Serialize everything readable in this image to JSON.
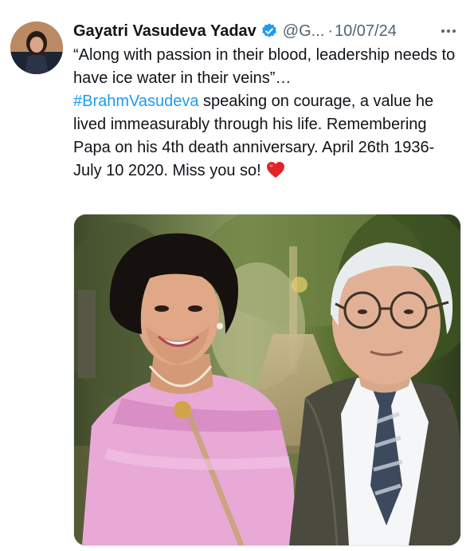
{
  "tweet": {
    "author_name": "Gayatri Vasudeva Yadav",
    "handle": "@G...",
    "separator": "·",
    "date": "10/07/24",
    "text_line1": "“Along with passion in their blood, leadership needs to have ice water in their veins”…",
    "hashtag": "#BrahmVasudeva",
    "text_line2": " speaking on courage, a value he lived immeasurably through his life. Remembering Papa on his 4th death anniversary. April 26th 1936-July 10 2020. Miss you so!",
    "icons": {
      "verified": "verified-badge-icon",
      "more": "more-options-icon",
      "heart": "red-heart-emoji"
    },
    "colors": {
      "hashtag": "#1d9bf0",
      "verified": "#1d9bf0",
      "secondary_text": "#536471",
      "heart": "#e0242b"
    }
  }
}
